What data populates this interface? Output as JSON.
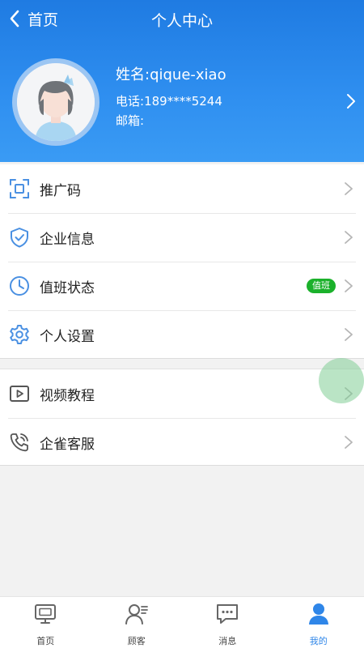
{
  "nav": {
    "back_label": "首页",
    "title": "个人中心"
  },
  "profile": {
    "name_label": "姓名:",
    "name": "qique-xiao",
    "phone_label": "电话:",
    "phone": "189****5244",
    "email_label": "邮箱:",
    "email": ""
  },
  "menu": {
    "group1": [
      {
        "label": "推广码",
        "icon": "qrcode-scan-icon"
      },
      {
        "label": "企业信息",
        "icon": "shield-check-icon"
      },
      {
        "label": "值班状态",
        "icon": "clock-icon",
        "badge": "值班"
      },
      {
        "label": "个人设置",
        "icon": "gear-icon"
      }
    ],
    "group2": [
      {
        "label": "视频教程",
        "icon": "video-play-icon"
      },
      {
        "label": "企雀客服",
        "icon": "phone-support-icon"
      }
    ]
  },
  "tabbar": [
    {
      "label": "首页",
      "icon": "monitor-icon",
      "active": false
    },
    {
      "label": "顾客",
      "icon": "customer-icon",
      "active": false
    },
    {
      "label": "消息",
      "icon": "message-icon",
      "active": false
    },
    {
      "label": "我的",
      "icon": "person-icon",
      "active": true
    }
  ],
  "colors": {
    "header_top": "#1f7be2",
    "header_bottom": "#3a9bf4",
    "accent": "#2f86e8",
    "badge_green": "#1bb12b",
    "icon_blue": "#4a90e2"
  }
}
